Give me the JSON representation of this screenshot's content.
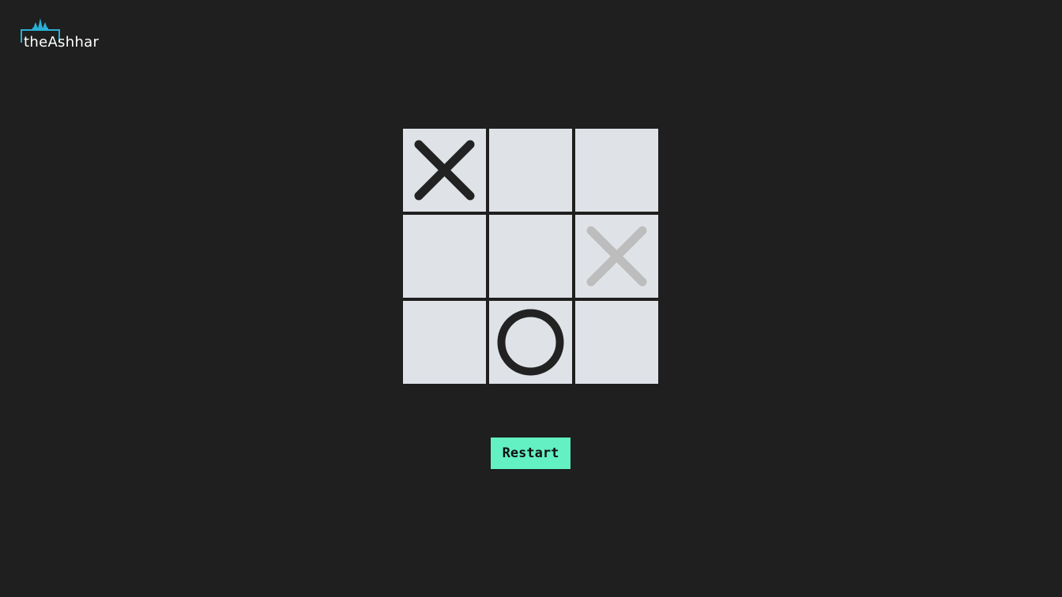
{
  "brand": {
    "logo_text": "theAshhar",
    "accent_color": "#2ab0d6"
  },
  "board": {
    "cells": [
      {
        "mark": "X",
        "state": "placed"
      },
      {
        "mark": "",
        "state": "empty"
      },
      {
        "mark": "",
        "state": "empty"
      },
      {
        "mark": "",
        "state": "empty"
      },
      {
        "mark": "",
        "state": "empty"
      },
      {
        "mark": "X",
        "state": "hover-preview"
      },
      {
        "mark": "",
        "state": "empty"
      },
      {
        "mark": "O",
        "state": "placed"
      },
      {
        "mark": "",
        "state": "empty"
      }
    ],
    "cell_color": "#dfe3e8",
    "mark_color": "#222222",
    "preview_color": "#bdbdbd"
  },
  "controls": {
    "restart_label": "Restart",
    "restart_color": "#63f0c2"
  }
}
